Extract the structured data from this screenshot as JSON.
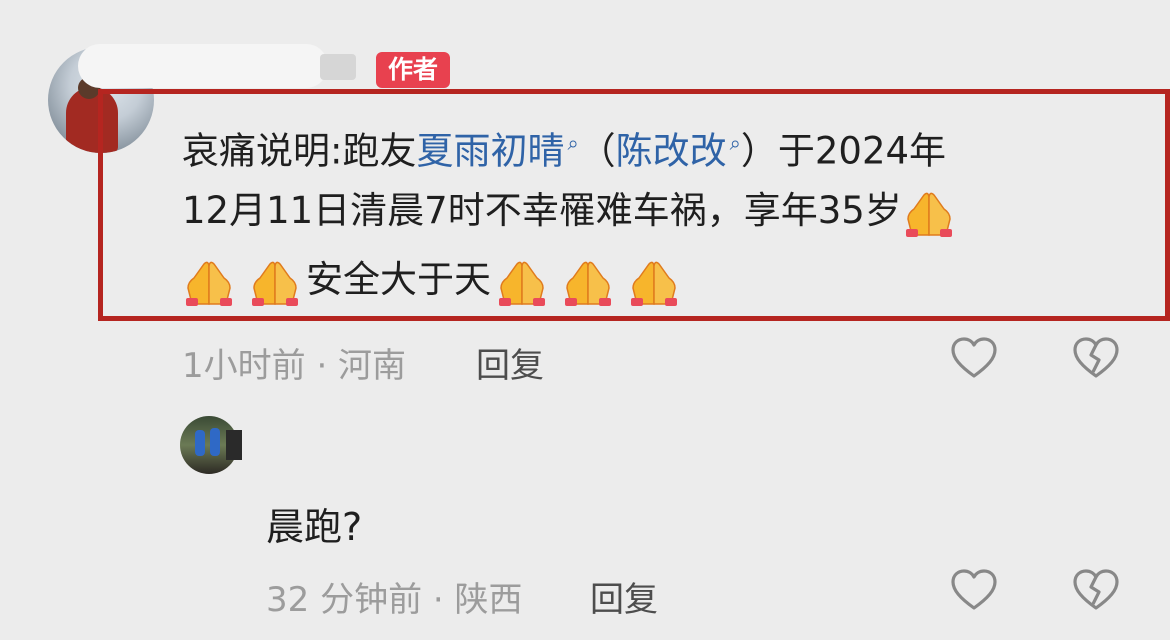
{
  "comment": {
    "author_badge": "作者",
    "line1_prefix": "哀痛说明:跑友",
    "link_1": "夏雨初晴",
    "paren_open": "（",
    "link_2": "陈改改",
    "paren_close": "）",
    "line1_suffix": "于2024年",
    "line2": "12月11日清晨7时不幸罹难车祸，享年35岁",
    "line3_text": "安全大于天",
    "meta": "1小时前 · 河南",
    "reply_label": "回复",
    "emoji": "pray-emoji"
  },
  "reply_comment": {
    "text": "晨跑?",
    "meta": "32 分钟前 · 陕西",
    "reply_label": "回复"
  },
  "colors": {
    "link": "#2f63a7",
    "badge": "#e8414f",
    "highlight_border": "#b52520",
    "background": "#ececec"
  },
  "icons": [
    "search-icon",
    "heart-icon",
    "broken-heart-icon",
    "pray-emoji"
  ]
}
